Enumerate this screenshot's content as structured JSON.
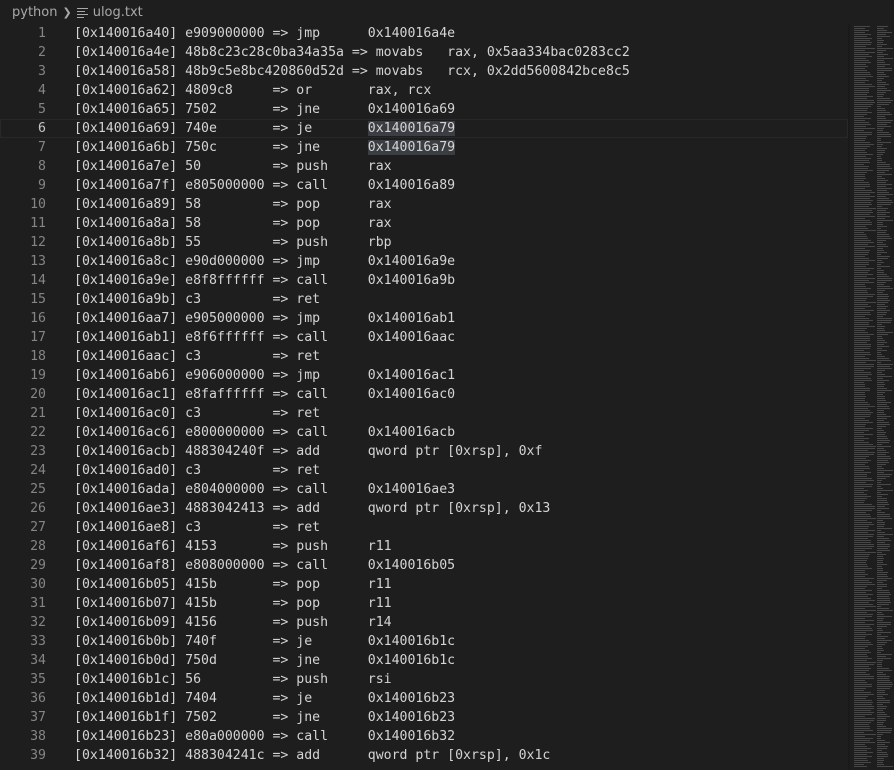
{
  "breadcrumb": {
    "folder": "python",
    "file": "ulog.txt"
  },
  "editor": {
    "current_line": 6,
    "highlighted_token": "0x140016a79",
    "lines": [
      {
        "num": "1",
        "text": "[0x140016a40] e909000000 => jmp      0x140016a4e"
      },
      {
        "num": "2",
        "text": "[0x140016a4e] 48b8c23c28c0ba34a35a => movabs   rax, 0x5aa334bac0283cc2"
      },
      {
        "num": "3",
        "text": "[0x140016a58] 48b9c5e8bc420860d52d => movabs   rcx, 0x2dd5600842bce8c5"
      },
      {
        "num": "4",
        "text": "[0x140016a62] 4809c8     => or       rax, rcx"
      },
      {
        "num": "5",
        "text": "[0x140016a65] 7502       => jne      0x140016a69"
      },
      {
        "num": "6",
        "text": "[0x140016a69] 740e       => je       0x140016a79"
      },
      {
        "num": "7",
        "text": "[0x140016a6b] 750c       => jne      0x140016a79"
      },
      {
        "num": "8",
        "text": "[0x140016a7e] 50         => push     rax"
      },
      {
        "num": "9",
        "text": "[0x140016a7f] e805000000 => call     0x140016a89"
      },
      {
        "num": "10",
        "text": "[0x140016a89] 58         => pop      rax"
      },
      {
        "num": "11",
        "text": "[0x140016a8a] 58         => pop      rax"
      },
      {
        "num": "12",
        "text": "[0x140016a8b] 55         => push     rbp"
      },
      {
        "num": "13",
        "text": "[0x140016a8c] e90d000000 => jmp      0x140016a9e"
      },
      {
        "num": "14",
        "text": "[0x140016a9e] e8f8ffffff => call     0x140016a9b"
      },
      {
        "num": "15",
        "text": "[0x140016a9b] c3         => ret"
      },
      {
        "num": "16",
        "text": "[0x140016aa7] e905000000 => jmp      0x140016ab1"
      },
      {
        "num": "17",
        "text": "[0x140016ab1] e8f6ffffff => call     0x140016aac"
      },
      {
        "num": "18",
        "text": "[0x140016aac] c3         => ret"
      },
      {
        "num": "19",
        "text": "[0x140016ab6] e906000000 => jmp      0x140016ac1"
      },
      {
        "num": "20",
        "text": "[0x140016ac1] e8faffffff => call     0x140016ac0"
      },
      {
        "num": "21",
        "text": "[0x140016ac0] c3         => ret"
      },
      {
        "num": "22",
        "text": "[0x140016ac6] e800000000 => call     0x140016acb"
      },
      {
        "num": "23",
        "text": "[0x140016acb] 488304240f => add      qword ptr [0xrsp], 0xf"
      },
      {
        "num": "24",
        "text": "[0x140016ad0] c3         => ret"
      },
      {
        "num": "25",
        "text": "[0x140016ada] e804000000 => call     0x140016ae3"
      },
      {
        "num": "26",
        "text": "[0x140016ae3] 4883042413 => add      qword ptr [0xrsp], 0x13"
      },
      {
        "num": "27",
        "text": "[0x140016ae8] c3         => ret"
      },
      {
        "num": "28",
        "text": "[0x140016af6] 4153       => push     r11"
      },
      {
        "num": "29",
        "text": "[0x140016af8] e808000000 => call     0x140016b05"
      },
      {
        "num": "30",
        "text": "[0x140016b05] 415b       => pop      r11"
      },
      {
        "num": "31",
        "text": "[0x140016b07] 415b       => pop      r11"
      },
      {
        "num": "32",
        "text": "[0x140016b09] 4156       => push     r14"
      },
      {
        "num": "33",
        "text": "[0x140016b0b] 740f       => je       0x140016b1c"
      },
      {
        "num": "34",
        "text": "[0x140016b0d] 750d       => jne      0x140016b1c"
      },
      {
        "num": "35",
        "text": "[0x140016b1c] 56         => push     rsi"
      },
      {
        "num": "36",
        "text": "[0x140016b1d] 7404       => je       0x140016b23"
      },
      {
        "num": "37",
        "text": "[0x140016b1f] 7502       => jne      0x140016b23"
      },
      {
        "num": "38",
        "text": "[0x140016b23] e80a000000 => call     0x140016b32"
      },
      {
        "num": "39",
        "text": "[0x140016b32] 488304241c => add      qword ptr [0xrsp], 0x1c"
      }
    ]
  },
  "colors": {
    "background": "#1e1e1e",
    "text": "#d4d4d4",
    "line_number": "#858585",
    "selection_highlight": "#3a3d41"
  },
  "icons": {
    "breadcrumb_separator": "chevron-right-icon",
    "file": "file-lines-icon"
  }
}
